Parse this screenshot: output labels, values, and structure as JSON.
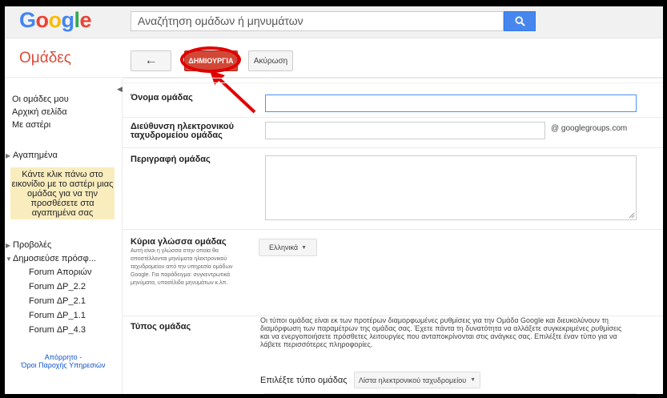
{
  "logo": {
    "letters": [
      "G",
      "o",
      "o",
      "g",
      "l",
      "e"
    ],
    "colors": [
      "#4285f4",
      "#ea4335",
      "#fbbc05",
      "#4285f4",
      "#34a853",
      "#ea4335"
    ]
  },
  "search": {
    "placeholder": "Αναζήτηση ομάδων ή μηνυμάτων",
    "icon": "search-icon"
  },
  "app_title": "Ομάδες",
  "toolbar": {
    "back_icon": "←",
    "create_label": "ΔΗΜΙΟΥΡΓΙΑ",
    "cancel_label": "Ακύρωση"
  },
  "sidebar": {
    "links": [
      "Οι ομάδες μου",
      "Αρχική σελίδα",
      "Με αστέρι"
    ],
    "favorites_label": "Αγαπημένα",
    "favorites_hint": "Κάντε κλικ πάνω στο εικονίδιο με το αστέρι μιας ομάδας για να την προσθέσετε στα αγαπημένα σας",
    "views_label": "Προβολές",
    "recent_label": "Δημοσιεύσε πρόσφ...",
    "recent_items": [
      "Forum Αποριών",
      "Forum ΔΡ_2.2",
      "Forum ΔΡ_2.1",
      "Forum ΔΡ_1.1",
      "Forum ΔΡ_4.3"
    ],
    "footer_privacy": "Απόρρητο -",
    "footer_terms": "Όροι Παροχής Υπηρεσιών"
  },
  "form": {
    "name_label": "Όνομα ομάδας",
    "email_label_1": "Διεύθυνση ηλεκτρονικού",
    "email_label_2": "ταχυδρομείου ομάδας",
    "email_suffix": "@ googlegroups.com",
    "description_label": "Περιγραφή ομάδας",
    "language_label": "Κύρια γλώσσα ομάδας",
    "language_help": "Αυτή είναι η γλώσσα στην οποία θα αποστέλλονται μηνύματα ηλεκτρονικού ταχυδρομείου από την υπηρεσία ομάδων Google. Για παράδειγμα: συγκεντρωτικά μηνύματα, υποσέλιδα μηνυμάτων κ.λπ.",
    "language_value": "Ελληνικά",
    "type_label": "Τύπος ομάδας",
    "type_description": "Οι τύποι ομάδας είναι εκ των προτέρων διαμορφωμένες ρυθμίσεις για την Ομάδα Google και διευκολύνουν τη διαμόρφωση των παραμέτρων της ομάδας σας. Έχετε πάντα τη δυνατότητα να αλλάξετε συγκεκριμένες ρυθμίσεις και να ενεργοποιήσετε πρόσθετες λειτουργίες που ανταποκρίνονται στις ανάγκες σας. Επιλέξτε έναν τύπο για να λάβετε περισσότερες πληροφορίες.",
    "type_choose_label": "Επιλέξτε τύπο ομάδας",
    "type_value": "Λίστα ηλεκτρονικού ταχυδρομείου"
  },
  "colors": {
    "accent_red": "#dd4b39",
    "search_blue": "#4787ed",
    "annotation_red": "#e00000"
  }
}
